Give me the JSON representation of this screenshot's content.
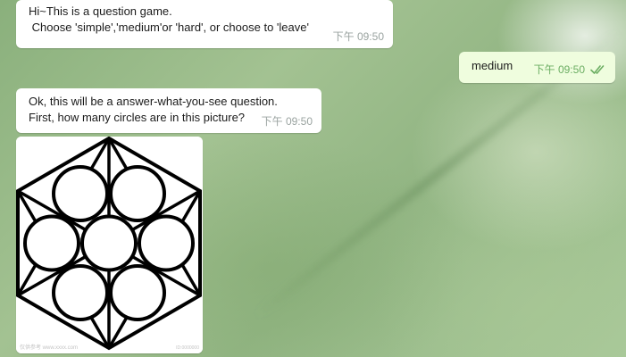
{
  "chat": {
    "messages": [
      {
        "direction": "incoming",
        "lines": [
          "Hi~This is a question game.",
          " Choose 'simple','medium'or 'hard', or choose to 'leave'"
        ],
        "time": "下午 09:50"
      },
      {
        "direction": "outgoing",
        "lines": [
          "medium"
        ],
        "time": "下午 09:50",
        "status": "read"
      },
      {
        "direction": "incoming",
        "lines": [
          "Ok, this will be a answer-what-you-see question.",
          "First, how many circles are in this picture?"
        ],
        "time": "下午 09:50"
      }
    ],
    "image": {
      "circle_count": 7,
      "watermark_left": "仅供参考 www.xxxx.com",
      "watermark_right": "ID:0000000"
    }
  },
  "colors": {
    "incoming_bubble": "#ffffff",
    "outgoing_bubble": "#effdde",
    "time_incoming": "#9aa3a0",
    "time_outgoing": "#6cae63"
  },
  "icons": {
    "read_status": "double-check-icon"
  }
}
